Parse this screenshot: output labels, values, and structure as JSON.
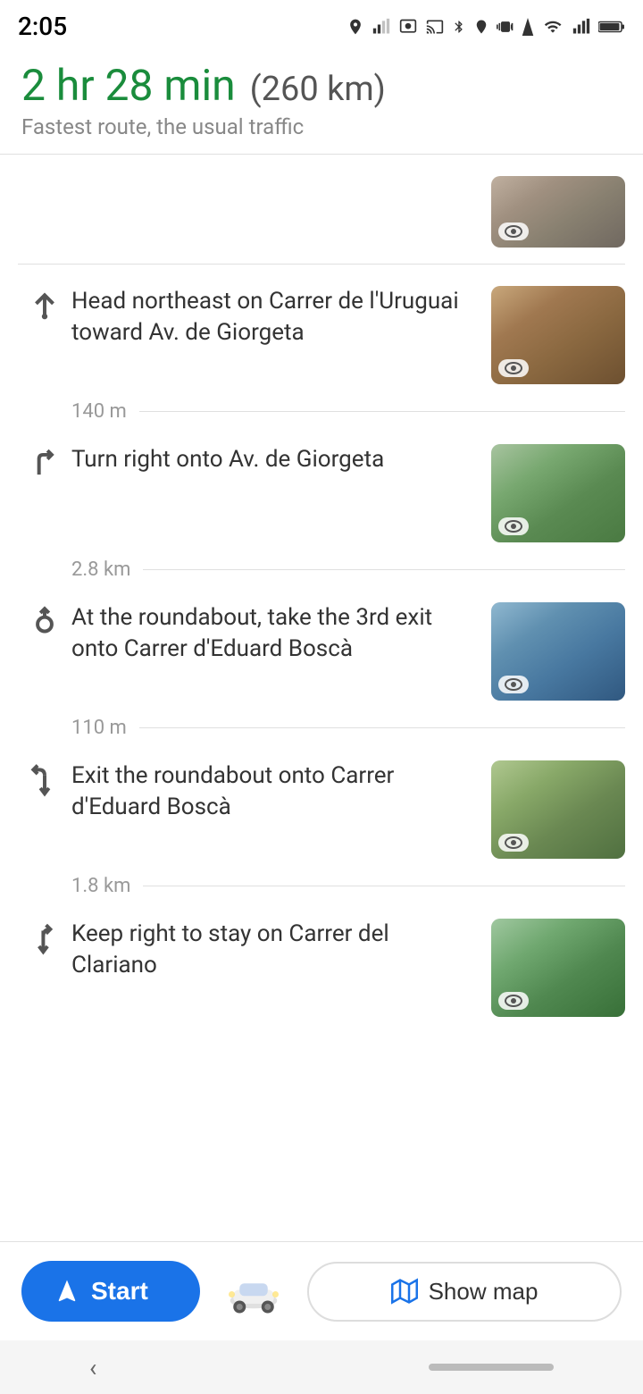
{
  "status_bar": {
    "time": "2:05",
    "icons": [
      "location",
      "signal",
      "screen-record",
      "cast",
      "bluetooth",
      "location2",
      "vibrate",
      "signal2",
      "wifi",
      "cellular",
      "battery"
    ]
  },
  "header": {
    "duration": "2 hr 28 min",
    "distance": "(260 km)",
    "subtitle": "Fastest route, the usual traffic"
  },
  "directions": [
    {
      "id": "step0",
      "icon_type": "partial-top",
      "text": "",
      "thumbnail_class": "top-partial",
      "partial": true
    },
    {
      "id": "step1",
      "icon_type": "arrow-up",
      "text": "Head northeast on Carrer de l'Uruguai toward Av. de Giorgeta",
      "thumbnail_class": "street1",
      "distance": "140 m"
    },
    {
      "id": "step2",
      "icon_type": "arrow-right",
      "text": "Turn right onto Av. de Giorgeta",
      "thumbnail_class": "street2",
      "distance": "2.8 km"
    },
    {
      "id": "step3",
      "icon_type": "roundabout",
      "text": "At the roundabout, take the 3rd exit onto Carrer d'Eduard Boscà",
      "thumbnail_class": "street3",
      "distance": "110 m"
    },
    {
      "id": "step4",
      "icon_type": "exit-left",
      "text": "Exit the roundabout onto Carrer d'Eduard Boscà",
      "thumbnail_class": "street4",
      "distance": "1.8 km"
    },
    {
      "id": "step5",
      "icon_type": "keep-right",
      "text": "Keep right to stay on Carrer del Clariano",
      "thumbnail_class": "street5",
      "distance": ""
    }
  ],
  "bottom_bar": {
    "start_label": "Start",
    "show_map_label": "Show map"
  }
}
